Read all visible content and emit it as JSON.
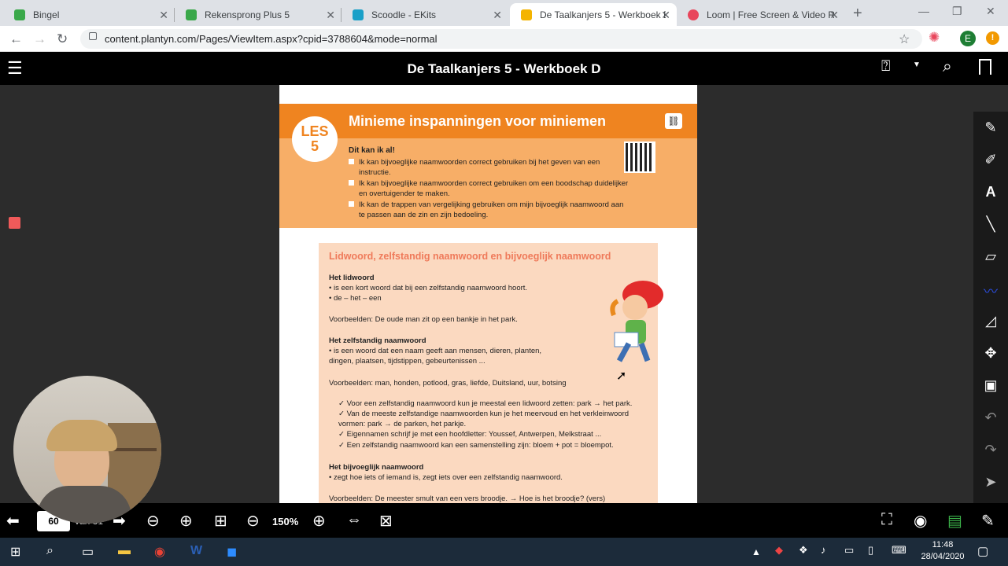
{
  "browser": {
    "tabs": [
      {
        "label": "Bingel",
        "color": "#3aa84a"
      },
      {
        "label": "Rekensprong Plus 5",
        "color": "#3aa84a"
      },
      {
        "label": "Scoodle - EKits",
        "color": "#1aa0c8"
      },
      {
        "label": "De Taalkanjers 5 - Werkboek D",
        "color": "#f4b400"
      },
      {
        "label": "Loom | Free Screen & Video Re",
        "color": "#e8455b"
      }
    ],
    "new_tab": "+",
    "url": "content.plantyn.com/Pages/ViewItem.aspx?cpid=3788604&mode=normal",
    "profile_initial": "E"
  },
  "app": {
    "title": "De Taalkanjers 5 - Werkboek D"
  },
  "document": {
    "les_label": "LES",
    "les_number": "5",
    "lesson_title": "Minieme inspanningen voor miniemen",
    "can_do_heading": "Dit kan ik al!",
    "can_do": [
      "Ik kan bijvoeglijke naamwoorden correct gebruiken bij het geven van een instructie.",
      "Ik kan bijvoeglijke naamwoorden correct gebruiken om een boodschap duidelijker en overtuigender te maken.",
      "Ik kan de trappen van vergelijking gebruiken om mijn bijvoeglijk naamwoord aan te passen aan de zin en zijn bedoeling."
    ],
    "box_title": "Lidwoord, zelfstandig naamwoord en bijvoeglijk naamwoord",
    "lidwoord_heading": "Het lidwoord",
    "lidwoord_items": [
      "is een kort woord dat bij een zelfstandig naamwoord hoort.",
      "de – het – een"
    ],
    "lidwoord_example": "Voorbeelden: De oude man zit op een bankje in het park.",
    "zn_heading": "Het zelfstandig naamwoord",
    "zn_items": [
      "is een woord dat een naam geeft aan mensen, dieren, planten, dingen, plaatsen, tijdstippen, gebeurtenissen ..."
    ],
    "zn_example": "Voorbeelden: man, honden, potlood, gras, liefde, Duitsland, uur, botsing",
    "zn_rules": [
      "Voor een zelfstandig naamwoord kun je meestal een lidwoord zetten: park → het park.",
      "Van de meeste zelfstandige naamwoorden kun je het meervoud en het verkleinwoord vormen: park → de parken, het parkje.",
      "Eigennamen schrijf je met een hoofdletter: Youssef, Antwerpen, Melkstraat ...",
      "Een zelfstandig naamwoord kan een samenstelling zijn: bloem + pot = bloempot."
    ],
    "bn_heading": "Het bijvoeglijk naamwoord",
    "bn_items": [
      "zegt hoe iets of iemand is, zegt iets over een zelfstandig naamwoord."
    ],
    "bn_example": "Voorbeelden: De meester smult van een vers broodje. → Hoe is het broodje? (vers)"
  },
  "viewer": {
    "page": "60",
    "of_label": "van 31",
    "zoom": "150%"
  },
  "taskbar": {
    "time": "11:48",
    "date": "28/04/2020"
  }
}
